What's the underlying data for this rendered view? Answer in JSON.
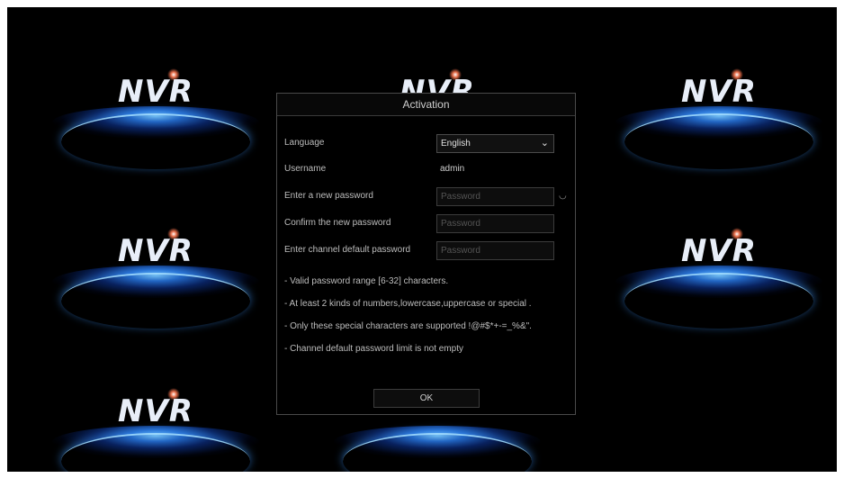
{
  "logo_text": "NVR",
  "dialog": {
    "title": "Activation",
    "fields": {
      "language_label": "Language",
      "language_value": "English",
      "username_label": "Username",
      "username_value": "admin",
      "new_password_label": "Enter a new password",
      "new_password_placeholder": "Password",
      "confirm_password_label": "Confirm the new password",
      "confirm_password_placeholder": "Password",
      "channel_password_label": "Enter channel default password",
      "channel_password_placeholder": "Password"
    },
    "hints": [
      "- Valid password range [6-32] characters.",
      "- At least 2 kinds of numbers,lowercase,uppercase or special .",
      "- Only these special characters are supported !@#$*+-=_%&\".",
      "- Channel default password limit is not empty"
    ],
    "ok_label": "OK"
  },
  "icons": {
    "language_dropdown": "chevron-down-icon",
    "show_password": "eye-icon"
  },
  "colors": {
    "background": "#000000",
    "logo_glow": "#2a78e8",
    "text": "#bdbdbd"
  }
}
